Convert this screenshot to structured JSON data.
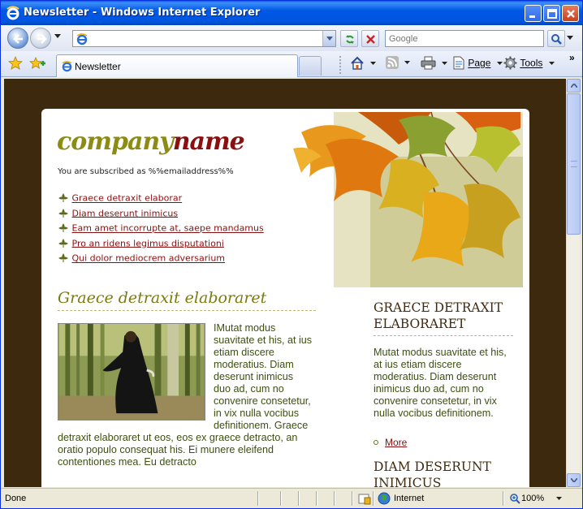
{
  "window": {
    "title": "Newsletter - Windows Internet Explorer"
  },
  "address_bar": {
    "url": "",
    "search_placeholder": "Google"
  },
  "tabs": [
    {
      "label": "Newsletter",
      "active": true
    }
  ],
  "commands": {
    "page_label": "Page",
    "tools_label": "Tools",
    "more": "»"
  },
  "newsletter": {
    "logo_part1": "company",
    "logo_part2": "name",
    "subscribed_text": "You are subscribed as %%emailaddress%%",
    "links": [
      "Graece detraxit elaborar",
      "Diam deserunt inimicus",
      "Eam amet incorrupte at, saepe mandamus",
      "Pro an ridens legimus disputationi",
      "Qui dolor mediocrem adversarium"
    ],
    "main_heading": "Graece detraxit elaboraret",
    "main_body": "IMutat modus suavitate et his, at ius etiam discere moderatius. Diam deserunt inimicus duo ad, cum no convenire consetetur, in vix nulla vocibus definitionem. Graece detraxit elaboraret ut eos, eos ex graece detracto, an oratio populo consequat his. Ei munere eleifend contentiones mea. Eu detracto",
    "side_heading1": "GRAECE DETRAXIT ELABORARET",
    "side_body": "Mutat modus suavitate et his, at ius etiam discere moderatius. Diam deserunt inimicus duo ad, cum no convenire consetetur, in vix nulla vocibus definitionem.",
    "side_more": "More",
    "side_heading2": "DIAM DESERUNT INIMICUS"
  },
  "status_bar": {
    "status": "Done",
    "zone": "Internet",
    "zoom": "100%"
  },
  "colors": {
    "page_background": "#3d2a0e",
    "logo_olive": "#8c8c14",
    "logo_red": "#8a1010",
    "link_red": "#8a1010",
    "body_text": "#3c5010",
    "titlebar_blue": "#0058e6"
  },
  "icons": {
    "ie_logo": "ie-logo-icon",
    "back": "back-arrow-icon",
    "forward": "forward-arrow-icon",
    "refresh": "refresh-icon",
    "stop": "stop-icon",
    "search": "magnifier-icon",
    "favorites": "star-icon",
    "add_favorites": "add-favorite-icon",
    "home": "home-icon",
    "feeds": "rss-icon",
    "print": "printer-icon",
    "page": "page-icon",
    "tools": "gear-icon",
    "internet_zone": "globe-icon",
    "zoom": "zoom-icon",
    "bullet": "fleur-bullet-icon"
  }
}
